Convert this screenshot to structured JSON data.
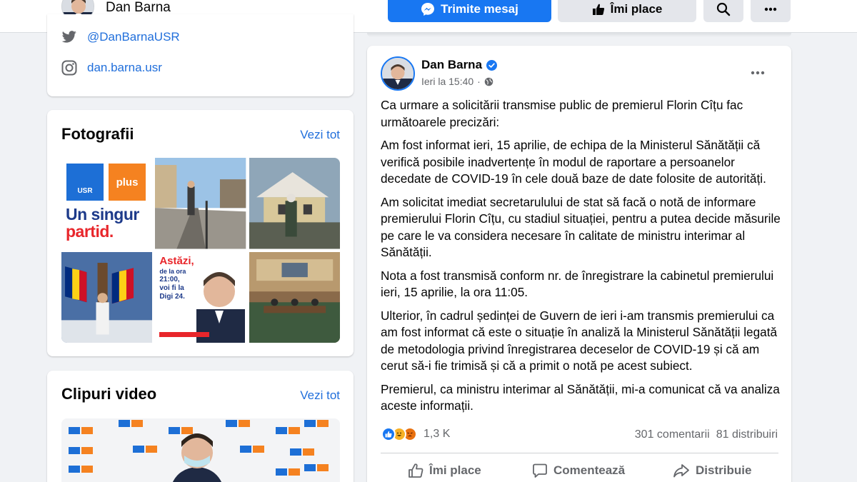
{
  "header": {
    "page_name": "Dan Barna",
    "message_button": "Trimite mesaj",
    "like_button": "Îmi place"
  },
  "intro": {
    "twitter": "@DanBarnaUSR",
    "instagram": "dan.barna.usr"
  },
  "photos": {
    "title": "Fotografii",
    "see_all": "Vezi tot",
    "tile1": {
      "logo_left": "USR",
      "logo_right": "plus",
      "line1": "Un singur",
      "line2": "partid."
    },
    "tile5": {
      "line1": "Astăzi,",
      "line2": "de la ora",
      "line3": "21:00,",
      "line4": "voi fi la",
      "line5": "Digi 24."
    }
  },
  "videos": {
    "title": "Clipuri video",
    "see_all": "Vezi tot"
  },
  "post": {
    "author": "Dan Barna",
    "time": "Ieri la 15:40",
    "paragraphs": [
      "Ca urmare a solicitării transmise public de premierul Florin Cîțu fac următoarele precizări:",
      "Am fost informat ieri, 15 aprilie, de echipa de la Ministerul Sănătății că verifică posibile inadvertențe în modul de raportare a persoanelor decedate de COVID-19 în cele două baze de date folosite de autorități.",
      "Am solicitat imediat secretarulului de stat să facă o notă de informare premierului Florin Cîțu, cu stadiul situației, pentru a putea decide măsurile pe care le va considera necesare în calitate de ministru interimar al Sănătății.",
      "Nota a fost transmisă conform nr. de înregistrare la cabinetul premierului ieri, 15 aprilie, la ora 11:05.",
      "Ulterior, în cadrul ședinței de Guvern de ieri i-am transmis premierului ca am fost informat că este o situație în analiză la Ministerul Sănătății legată de metodologia privind înregistrarea deceselor de COVID-19 și că am cerut să-i fie trimisă și că a primit o notă pe acest subiect.",
      "Premierul, ca ministru interimar al Sănătății, mi-a comunicat că va analiza aceste informații."
    ],
    "reaction_count": "1,3 K",
    "comments": "301 comentarii",
    "shares": "81 distribuiri",
    "actions": {
      "like": "Îmi place",
      "comment": "Comentează",
      "share": "Distribuie"
    }
  },
  "colors": {
    "facebook_blue": "#1877f2",
    "link_blue": "#216fdb",
    "usr_blue": "#1d6fd6",
    "plus_orange": "#f58220"
  }
}
